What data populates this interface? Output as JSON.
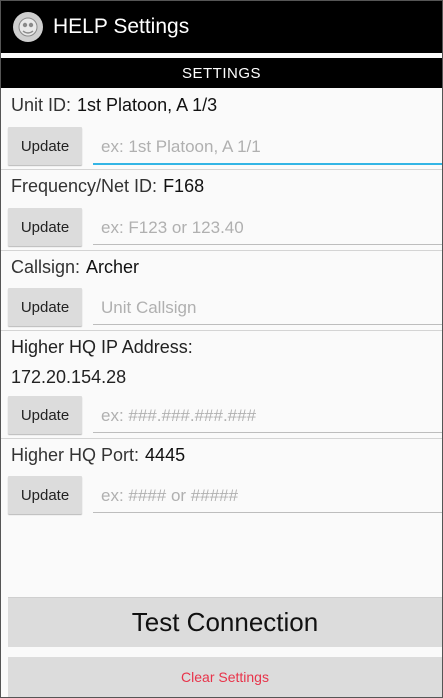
{
  "app": {
    "title": "HELP Settings",
    "icon": "app-logo-icon"
  },
  "section": {
    "title": "SETTINGS"
  },
  "fields": [
    {
      "label": "Unit ID:",
      "value": "1st Platoon, A 1/3",
      "placeholder": "ex: 1st Platoon, A 1/1",
      "button": "Update"
    },
    {
      "label": "Frequency/Net ID:",
      "value": "F168",
      "placeholder": "ex: F123 or 123.40",
      "button": "Update"
    },
    {
      "label": "Callsign:",
      "value": "Archer",
      "placeholder": "Unit Callsign",
      "button": "Update"
    },
    {
      "label": "Higher HQ IP Address:",
      "value": "172.20.154.28",
      "placeholder": "ex: ###.###.###.###",
      "button": "Update"
    },
    {
      "label": "Higher HQ Port:",
      "value": "4445",
      "placeholder": "ex: #### or #####",
      "button": "Update"
    }
  ],
  "actions": {
    "test_connection": "Test Connection",
    "clear_settings": "Clear Settings"
  },
  "colors": {
    "titlebar": "#000000",
    "focus_accent": "#33b5e5",
    "clear_text": "#e8334a",
    "button_bg": "#dcdcdc"
  }
}
